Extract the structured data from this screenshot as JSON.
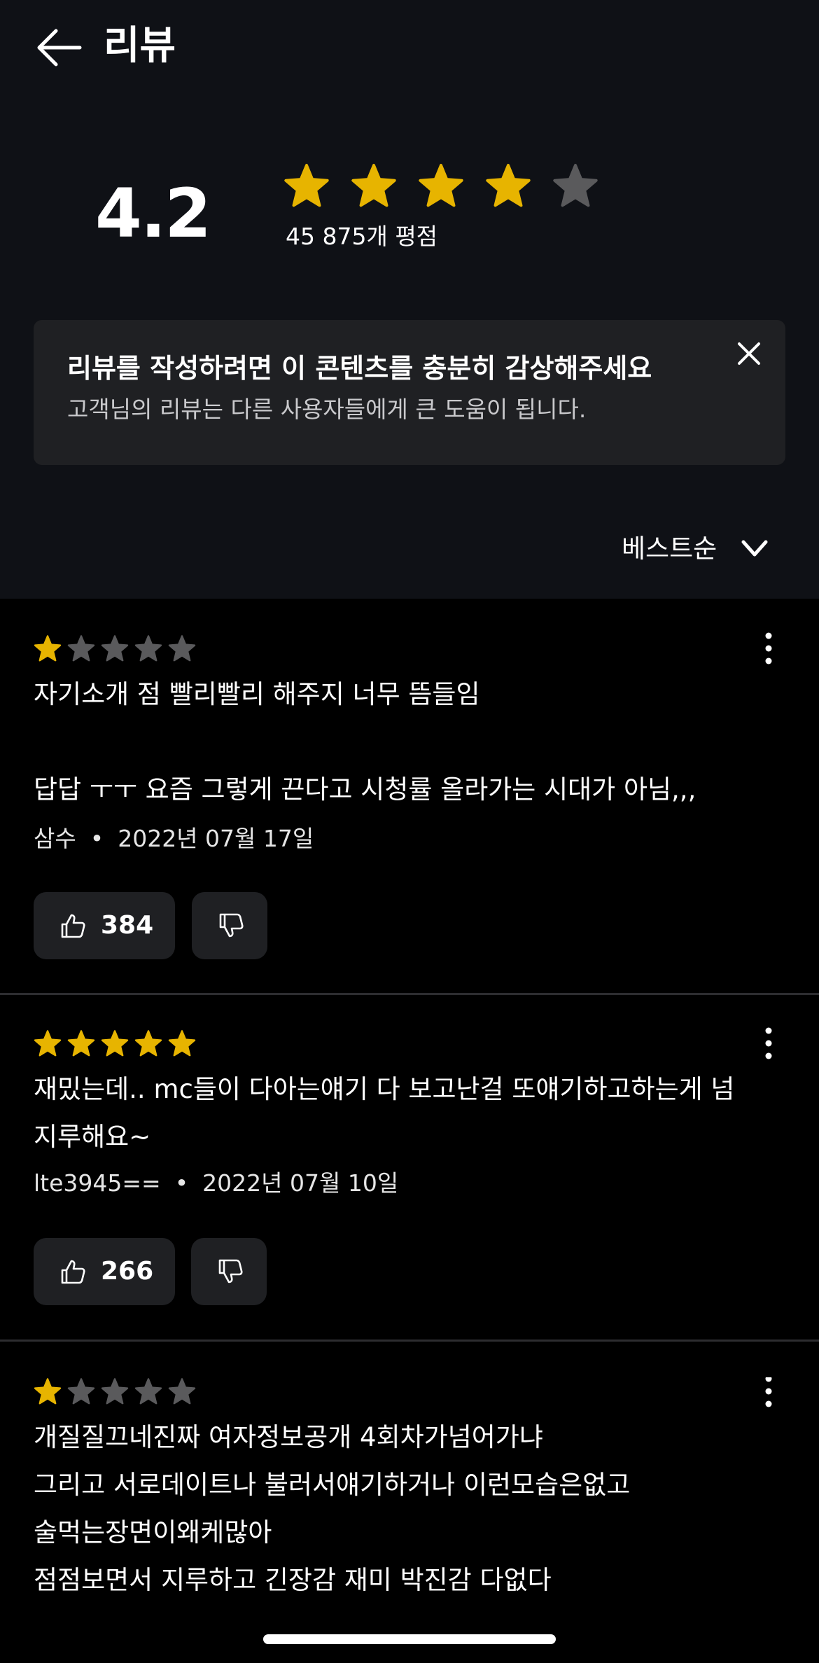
{
  "header": {
    "title": "리뷰",
    "back_icon": "arrow-left-icon"
  },
  "summary": {
    "rating": "4.2",
    "stars_filled": 4,
    "stars_total": 5,
    "count_text": "45 875개 평점"
  },
  "notice": {
    "title": "리뷰를 작성하려면 이 콘텐츠를 충분히 감상해주세요",
    "subtitle": "고객님의 리뷰는 다른 사용자들에게 큰 도움이 됩니다.",
    "close_icon": "close-icon"
  },
  "sort": {
    "label": "베스트순",
    "icon": "chevron-down-icon"
  },
  "reviews": [
    {
      "stars": 1,
      "text": "자기소개 점 빨리빨리 해주지 너무 뜸들임\n\n답답 ㅜㅜ 요즘 그렇게 끈다고 시청률 올라가는 시대가 아님,,,",
      "author": "삼수",
      "date": "2022년 07월 17일",
      "likes": "384"
    },
    {
      "stars": 5,
      "text": "재밌는데.. mc들이 다아는얘기 다 보고난걸 또얘기하고하는게 넘\n지루해요~",
      "author": "lte3945==",
      "date": "2022년 07월 10일",
      "likes": "266"
    },
    {
      "stars": 1,
      "text": "개질질끄네진짜 여자정보공개 4회차가넘어가냐\n그리고 서로데이트나 불러서얘기하거나 이런모습은없고\n술먹는장면이왜케많아\n점점보면서 지루하고 긴장감 재미 박진감 다없다",
      "author": "",
      "date": "",
      "likes": ""
    }
  ],
  "colors": {
    "star_filled": "#e7b400",
    "star_empty": "#5a5a5c",
    "background_top": "#0f1116",
    "card": "#1f2023"
  }
}
